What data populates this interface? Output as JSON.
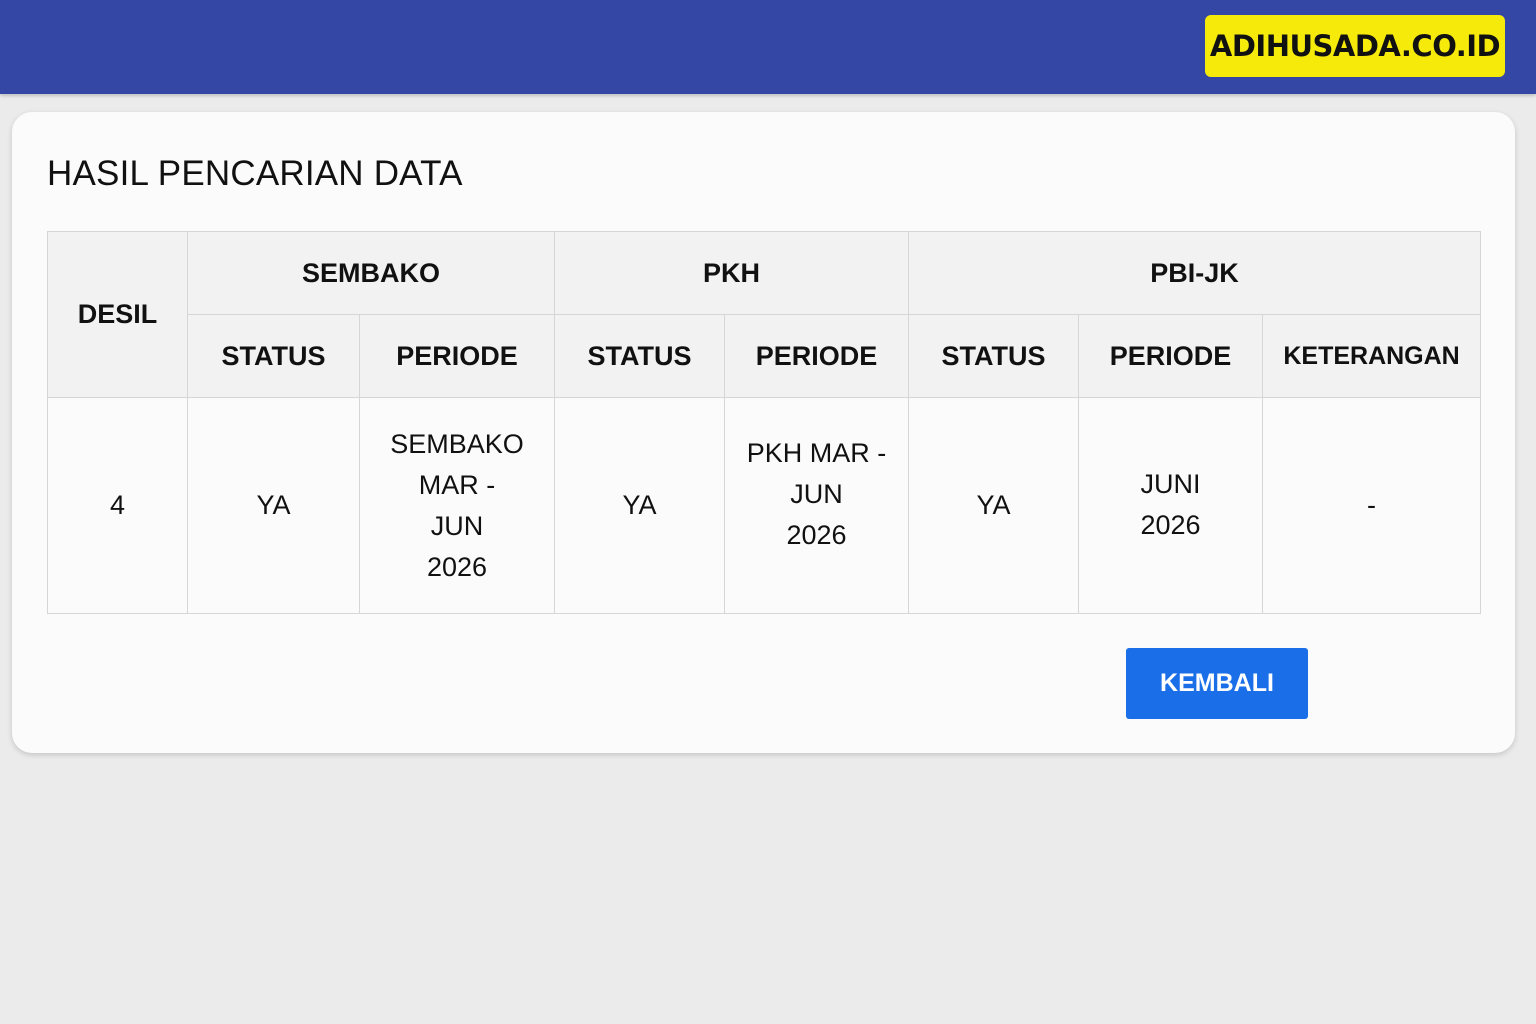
{
  "header": {
    "brand": "ADIHUSADA.CO.ID"
  },
  "page": {
    "title": "HASIL PENCARIAN DATA"
  },
  "table": {
    "desil_header": "DESIL",
    "groups": [
      "SEMBAKO",
      "PKH",
      "PBI-JK"
    ],
    "subheaders": [
      "STATUS",
      "PERIODE",
      "STATUS",
      "PERIODE",
      "STATUS",
      "PERIODE",
      "KETERANGAN"
    ],
    "row": {
      "desil": "4",
      "sembako_status": "YA",
      "sembako_periode": [
        "SEMBAKO",
        "MAR -",
        "JUN",
        "2026"
      ],
      "pkh_status": "YA",
      "pkh_periode": [
        "PKH MAR -",
        "JUN",
        "2026"
      ],
      "pbi_status": "YA",
      "pbi_periode": [
        "JUNI",
        "2026"
      ],
      "keterangan": "-"
    }
  },
  "actions": {
    "back_label": "KEMBALI"
  },
  "colors": {
    "topbar": "#3547a5",
    "brand_bg": "#f5ea0a",
    "button": "#1a6ee8"
  }
}
